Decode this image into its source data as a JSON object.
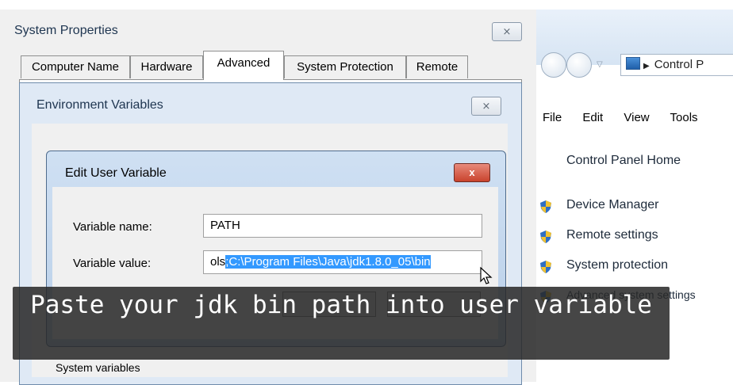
{
  "system_properties": {
    "title": "System Properties",
    "close_glyph": "⨯",
    "tabs": [
      {
        "label": "Computer Name"
      },
      {
        "label": "Hardware"
      },
      {
        "label": "Advanced"
      },
      {
        "label": "System Protection"
      },
      {
        "label": "Remote"
      }
    ]
  },
  "environment_variables": {
    "title": "Environment Variables",
    "close_glyph": "⨯",
    "system_variables_label": "System variables"
  },
  "edit_user_variable": {
    "title": "Edit User Variable",
    "close_glyph": "x",
    "name_label": "Variable name:",
    "name_value": "PATH",
    "value_label": "Variable value:",
    "value_prefix": "ols",
    "value_selected": ";C:\\Program Files\\Java\\jdk1.8.0_05\\bin"
  },
  "control_panel": {
    "address": "Control P",
    "menu": [
      "File",
      "Edit",
      "View",
      "Tools"
    ],
    "home_link": "Control Panel Home",
    "links": [
      "Device Manager",
      "Remote settings",
      "System protection",
      "Advanced system settings"
    ]
  },
  "caption": {
    "text": "Paste your jdk bin path into user variable"
  },
  "colors": {
    "selection": "#3399ff",
    "shield_blue": "#2f6fc4",
    "shield_yellow": "#f2c230"
  }
}
